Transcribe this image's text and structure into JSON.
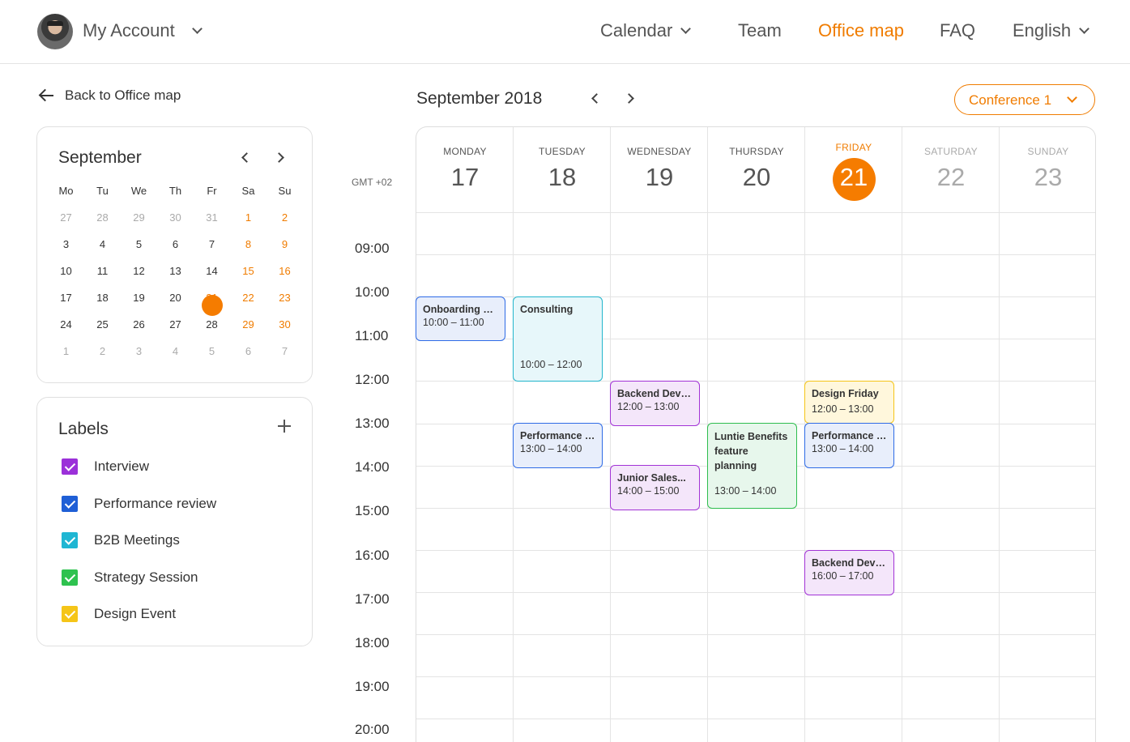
{
  "header": {
    "account_label": "My Account",
    "nav": [
      {
        "label": "Calendar"
      },
      {
        "label": "Team"
      },
      {
        "label": "Office map"
      },
      {
        "label": "FAQ"
      },
      {
        "label": "English"
      }
    ]
  },
  "sidebar": {
    "back_label": "Back to Office map",
    "mini_calendar": {
      "month": "September",
      "weekdays": [
        "Mo",
        "Tu",
        "We",
        "Th",
        "Fr",
        "Sa",
        "Su"
      ],
      "weeks": [
        [
          "27",
          "28",
          "29",
          "30",
          "31",
          "1",
          "2"
        ],
        [
          "3",
          "4",
          "5",
          "6",
          "7",
          "8",
          "9"
        ],
        [
          "10",
          "11",
          "12",
          "13",
          "14",
          "15",
          "16"
        ],
        [
          "17",
          "18",
          "19",
          "20",
          "21",
          "22",
          "23"
        ],
        [
          "24",
          "25",
          "26",
          "27",
          "28",
          "29",
          "30"
        ],
        [
          "1",
          "2",
          "3",
          "4",
          "5",
          "6",
          "7"
        ]
      ],
      "selected_day": "21"
    },
    "labels": {
      "title": "Labels",
      "items": [
        {
          "label": "Interview",
          "color": "#9b30d9"
        },
        {
          "label": "Performance review",
          "color": "#1f5fd6"
        },
        {
          "label": "B2B Meetings",
          "color": "#1fb6d3"
        },
        {
          "label": "Strategy Session",
          "color": "#2ec24f"
        },
        {
          "label": "Design Event",
          "color": "#f5c518"
        }
      ]
    }
  },
  "main": {
    "month_title": "September 2018",
    "room": "Conference 1",
    "timezone": "GMT +02",
    "days": [
      {
        "name": "MONDAY",
        "num": "17"
      },
      {
        "name": "TUESDAY",
        "num": "18"
      },
      {
        "name": "WEDNESDAY",
        "num": "19"
      },
      {
        "name": "THURSDAY",
        "num": "20"
      },
      {
        "name": "FRIDAY",
        "num": "21"
      },
      {
        "name": "SATURDAY",
        "num": "22"
      },
      {
        "name": "SUNDAY",
        "num": "23"
      }
    ],
    "times": [
      "09:00",
      "10:00",
      "11:00",
      "12:00",
      "13:00",
      "14:00",
      "15:00",
      "16:00",
      "17:00",
      "18:00",
      "19:00",
      "20:00"
    ],
    "events": [
      {
        "title": "Onboarding Ol...",
        "time": "10:00 – 11:00"
      },
      {
        "title": "Consulting",
        "time": "10:00 – 12:00"
      },
      {
        "title": "Backend Deve...",
        "time": "12:00 – 13:00"
      },
      {
        "title": "Design Friday",
        "time": "12:00 – 13:00"
      },
      {
        "title": "Performance r...",
        "time": "13:00 – 14:00"
      },
      {
        "title": "Luntie Benefits feature planning",
        "time": "13:00 – 14:00"
      },
      {
        "title": "Performance r...",
        "time": "13:00 – 14:00"
      },
      {
        "title": "Junior Sales...",
        "time": "14:00 – 15:00"
      },
      {
        "title": "Backend Deve...",
        "time": "16:00 – 17:00"
      }
    ]
  }
}
